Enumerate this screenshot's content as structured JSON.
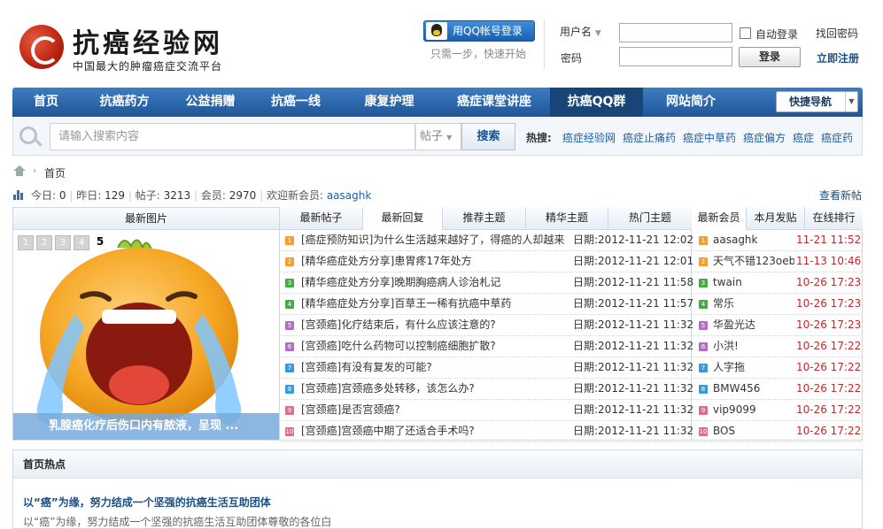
{
  "site": {
    "title": "抗癌经验网",
    "subtitle": "中国最大的肿瘤癌症交流平台"
  },
  "login": {
    "qq_button": "用QQ帐号登录",
    "qq_note": "只需一步，快速开始",
    "username_label": "用户名",
    "password_label": "密码",
    "auto_login": "自动登录",
    "find_password": "找回密码",
    "login_button": "登录",
    "register": "立即注册"
  },
  "nav": {
    "items": [
      "首页",
      "抗癌药方",
      "公益捐赠",
      "抗癌一线",
      "康复护理",
      "癌症课堂讲座",
      "抗癌QQ群",
      "网站简介"
    ],
    "active_index": 6,
    "quick_nav": "快捷导航"
  },
  "search": {
    "placeholder": "请输入搜索内容",
    "type": "帖子",
    "button": "搜索",
    "hot_label": "热搜:",
    "hot_links": [
      "癌症经验网",
      "癌症止痛药",
      "癌症中草药",
      "癌症偏方",
      "癌症",
      "癌症药"
    ]
  },
  "breadcrumb": {
    "current": "首页"
  },
  "stats": {
    "today_label": "今日:",
    "today": "0",
    "yesterday_label": "昨日:",
    "yesterday": "129",
    "posts_label": "帖子:",
    "posts": "3213",
    "members_label": "会员:",
    "members": "2970",
    "welcome": "欢迎新会员:",
    "new_member": "aasaghk",
    "view_new": "查看新帖"
  },
  "slideshow": {
    "header": "最新图片",
    "pages": [
      "1",
      "2",
      "3",
      "4",
      "5"
    ],
    "current": "5",
    "caption": "乳腺癌化疗后伤口内有脓液，呈现 ..."
  },
  "post_tabs": [
    "最新帖子",
    "最新回复",
    "推荐主题",
    "精华主题",
    "热门主题"
  ],
  "post_active_tab": 1,
  "posts": [
    {
      "num": "1",
      "color": "#f0a030",
      "title": "[癌症预防知识]为什么生活越来越好了，得癌的人却越来",
      "date": "日期:2012-11-21 12:02"
    },
    {
      "num": "2",
      "color": "#f0a030",
      "title": "[精华癌症处方分享]患胃疼17年处方",
      "date": "日期:2012-11-21 12:01"
    },
    {
      "num": "3",
      "color": "#4aa84a",
      "title": "[精华癌症处方分享]晚期胸癌病人诊治札记",
      "date": "日期:2012-11-21 11:58"
    },
    {
      "num": "4",
      "color": "#4aa84a",
      "title": "[精华癌症处方分享]百草王一稀有抗癌中草药",
      "date": "日期:2012-11-21 11:57"
    },
    {
      "num": "5",
      "color": "#b070c0",
      "title": "[宫颈癌]化疗结束后，有什么应该注意的?",
      "date": "日期:2012-11-21 11:32"
    },
    {
      "num": "6",
      "color": "#b070c0",
      "title": "[宫颈癌]吃什么药物可以控制癌细胞扩散?",
      "date": "日期:2012-11-21 11:32"
    },
    {
      "num": "7",
      "color": "#3a9ad8",
      "title": "[宫颈癌]有没有复发的可能?",
      "date": "日期:2012-11-21 11:32"
    },
    {
      "num": "8",
      "color": "#3a9ad8",
      "title": "[宫颈癌]宫颈癌多处转移，该怎么办?",
      "date": "日期:2012-11-21 11:32"
    },
    {
      "num": "9",
      "color": "#d87090",
      "title": "[宫颈癌]是否宫颈癌?",
      "date": "日期:2012-11-21 11:32"
    },
    {
      "num": "10",
      "color": "#d87090",
      "title": "[宫颈癌]宫颈癌中期了还适合手术吗?",
      "date": "日期:2012-11-21 11:32"
    }
  ],
  "member_tabs": [
    "最新会员",
    "本月发贴",
    "在线排行"
  ],
  "member_active_tab": 0,
  "members": [
    {
      "num": "1",
      "color": "#f0a030",
      "name": "aasaghk",
      "date": "11-21 11:52"
    },
    {
      "num": "2",
      "color": "#f0a030",
      "name": "天气不错123oeb",
      "date": "11-13 10:46"
    },
    {
      "num": "3",
      "color": "#4aa84a",
      "name": "twain",
      "date": "10-26 17:23"
    },
    {
      "num": "4",
      "color": "#4aa84a",
      "name": "常乐",
      "date": "10-26 17:23"
    },
    {
      "num": "5",
      "color": "#b070c0",
      "name": "华盈光达",
      "date": "10-26 17:23"
    },
    {
      "num": "6",
      "color": "#b070c0",
      "name": "小洪!",
      "date": "10-26 17:22"
    },
    {
      "num": "7",
      "color": "#3a9ad8",
      "name": "人字拖",
      "date": "10-26 17:22"
    },
    {
      "num": "8",
      "color": "#3a9ad8",
      "name": "BMW456",
      "date": "10-26 17:22"
    },
    {
      "num": "9",
      "color": "#d87090",
      "name": "vip9099",
      "date": "10-26 17:22"
    },
    {
      "num": "10",
      "color": "#d87090",
      "name": "BOS",
      "date": "10-26 17:22"
    }
  ],
  "home_hot": {
    "header": "首页热点",
    "title": "以“癌”为缘，努力结成一个坚强的抗癌生活互助团体",
    "desc": "以“癌”为缘，努力结成一个坚强的抗癌生活互助团体尊敬的各位白"
  }
}
